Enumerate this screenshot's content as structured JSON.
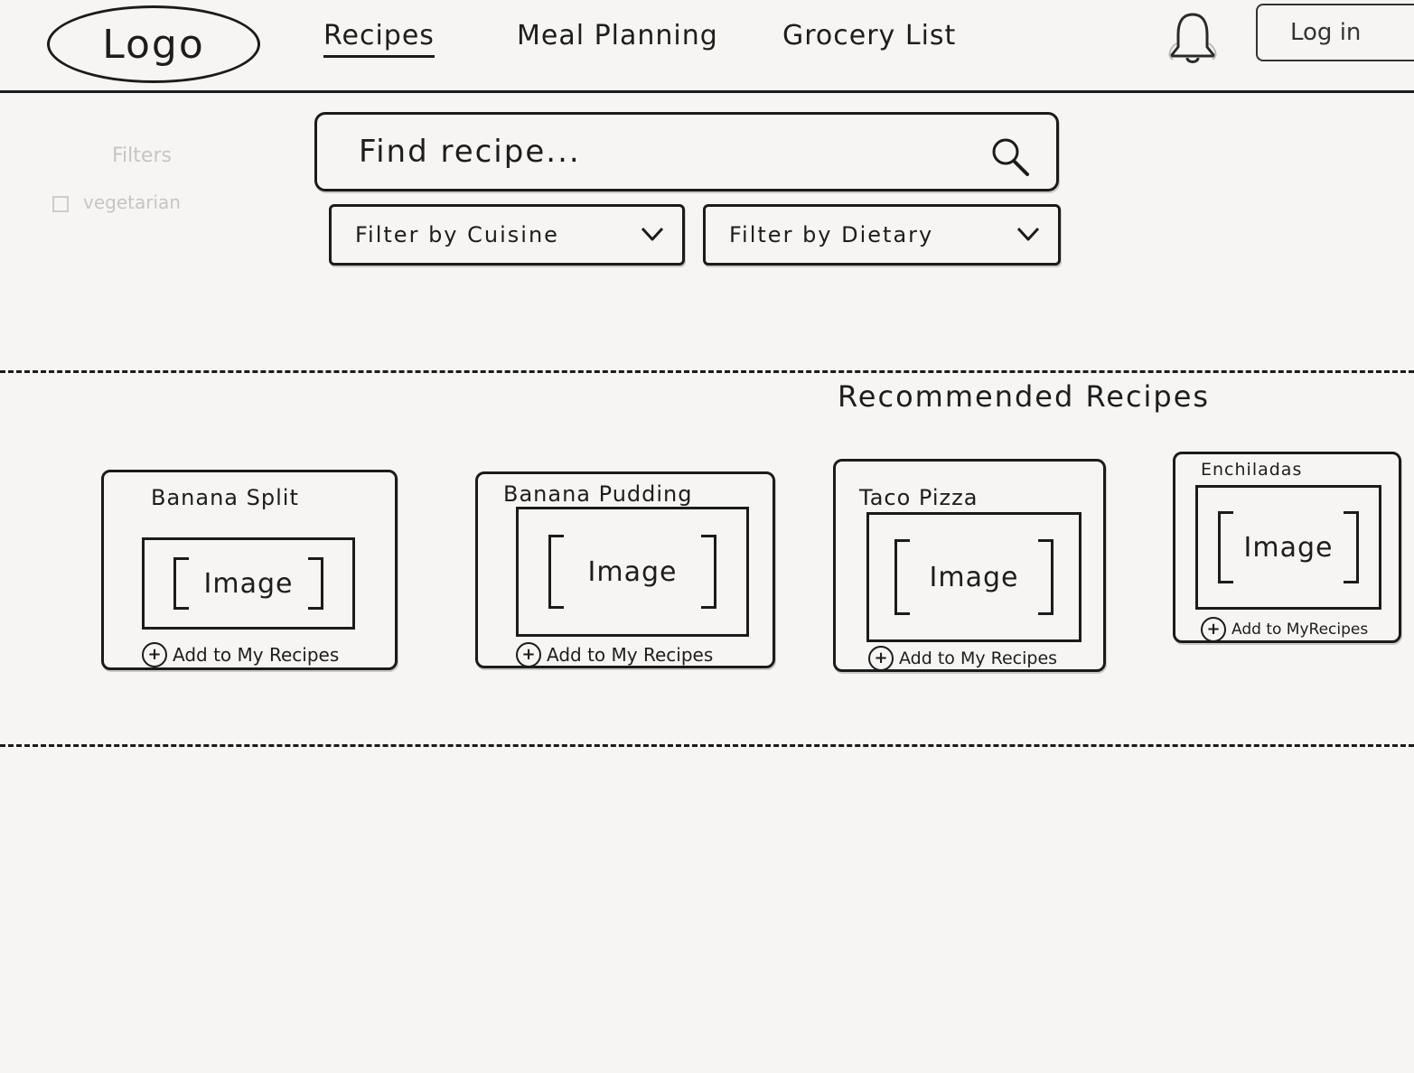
{
  "header": {
    "logo": "Logo",
    "nav": {
      "recipes": "Recipes",
      "meal_planning": "Meal Planning",
      "grocery_list": "Grocery List"
    },
    "login": "Log in",
    "bell_icon": "bell-icon"
  },
  "search": {
    "placeholder": "Find recipe...",
    "icon": "search-icon"
  },
  "filters": {
    "cuisine": "Filter by Cuisine",
    "dietary": "Filter by Dietary"
  },
  "ghost_sidebar": {
    "title": "Filters",
    "option": "vegetarian"
  },
  "recommended": {
    "title": "Recommended Recipes",
    "cards": [
      {
        "title": "Banana Split",
        "image": "Image",
        "add": "Add to My Recipes"
      },
      {
        "title": "Banana Pudding",
        "image": "Image",
        "add": "Add to My Recipes"
      },
      {
        "title": "Taco Pizza",
        "image": "Image",
        "add": "Add to My Recipes"
      },
      {
        "title": "Enchiladas",
        "image": "Image",
        "add": "Add to MyRecipes"
      }
    ]
  }
}
